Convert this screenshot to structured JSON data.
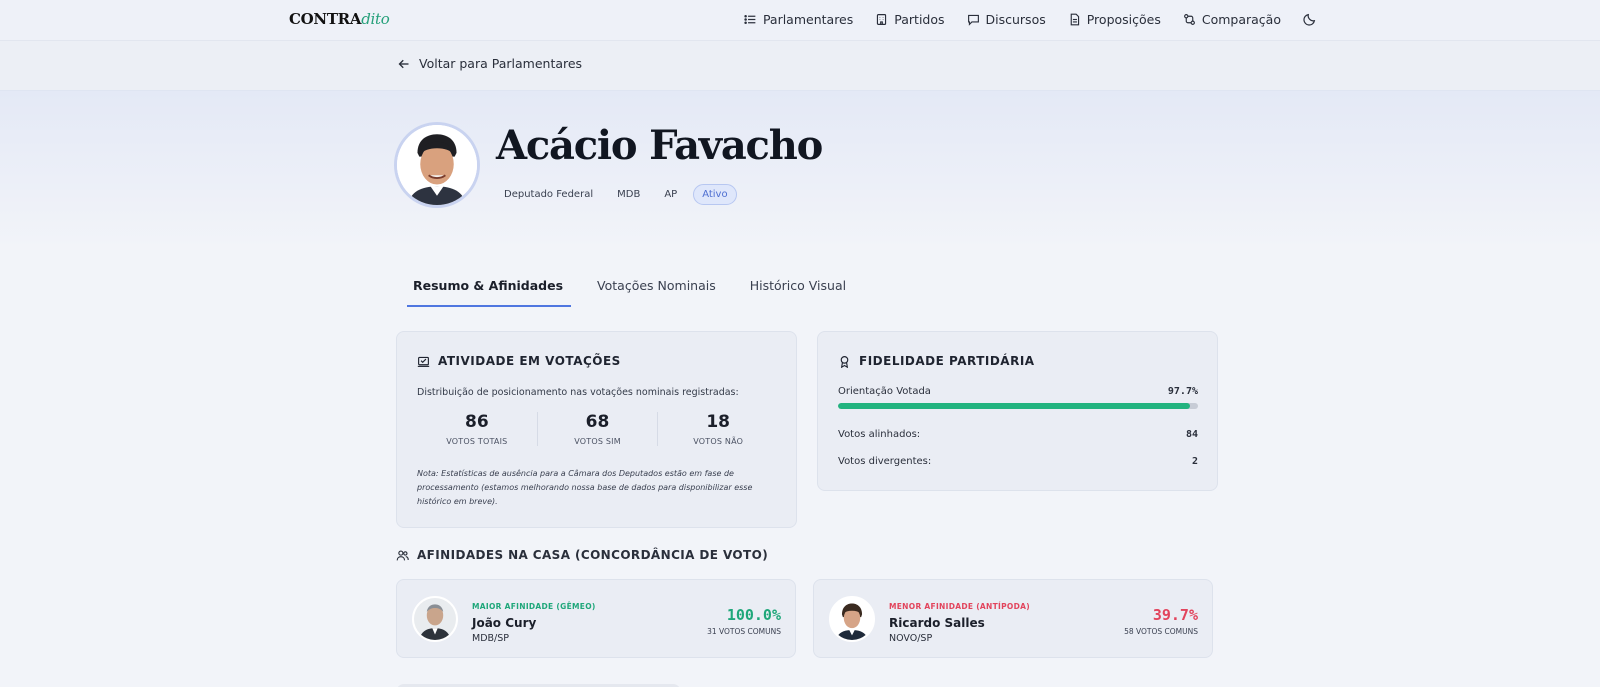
{
  "nav": {
    "logo_main": "CONTRA",
    "logo_accent": "dito",
    "links": [
      {
        "label": "Parlamentares",
        "icon": "list-icon"
      },
      {
        "label": "Partidos",
        "icon": "building-icon"
      },
      {
        "label": "Discursos",
        "icon": "chat-icon"
      },
      {
        "label": "Proposições",
        "icon": "document-icon"
      },
      {
        "label": "Comparação",
        "icon": "compare-icon"
      }
    ],
    "theme_icon": "moon-icon"
  },
  "back": {
    "label": "Voltar para Parlamentares"
  },
  "profile": {
    "name": "Acácio Favacho",
    "role": "Deputado Federal",
    "party": "MDB",
    "state": "AP",
    "status": "Ativo"
  },
  "tabs": [
    {
      "label": "Resumo & Afinidades",
      "active": true
    },
    {
      "label": "Votações Nominais",
      "active": false
    },
    {
      "label": "Histórico Visual",
      "active": false
    }
  ],
  "activity": {
    "title": "ATIVIDADE EM VOTAÇÕES",
    "description": "Distribuição de posicionamento nas votações nominais registradas:",
    "stats": [
      {
        "value": "86",
        "label": "VOTOS TOTAIS"
      },
      {
        "value": "68",
        "label": "VOTOS SIM"
      },
      {
        "value": "18",
        "label": "VOTOS NÃO"
      }
    ],
    "note": "Nota: Estatísticas de ausência para a Câmara dos Deputados estão em fase de processamento (estamos melhorando nossa base de dados para disponibilizar esse histórico em breve)."
  },
  "fidelity": {
    "title": "FIDELIDADE PARTIDÁRIA",
    "orientation_label": "Orientação Votada",
    "orientation_value": "97.7%",
    "orientation_fraction": 0.977,
    "aligned_label": "Votos alinhados:",
    "aligned_value": "84",
    "divergent_label": "Votos divergentes:",
    "divergent_value": "2",
    "bar_color": "#22b37f"
  },
  "affinities": {
    "title": "AFINIDADES NA CASA (CONCORDÂNCIA DE VOTO)",
    "max": {
      "kind": "MAIOR AFINIDADE (GÊMEO)",
      "name": "João Cury",
      "party": "MDB/SP",
      "pct": "100.0%",
      "common": "31 VOTOS COMUNS",
      "color": "#1fa77a"
    },
    "min": {
      "kind": "MENOR AFINIDADE (ANTÍPODA)",
      "name": "Ricardo Salles",
      "party": "NOVO/SP",
      "pct": "39.7%",
      "common": "58 VOTOS COMUNS",
      "color": "#e2445c"
    }
  }
}
